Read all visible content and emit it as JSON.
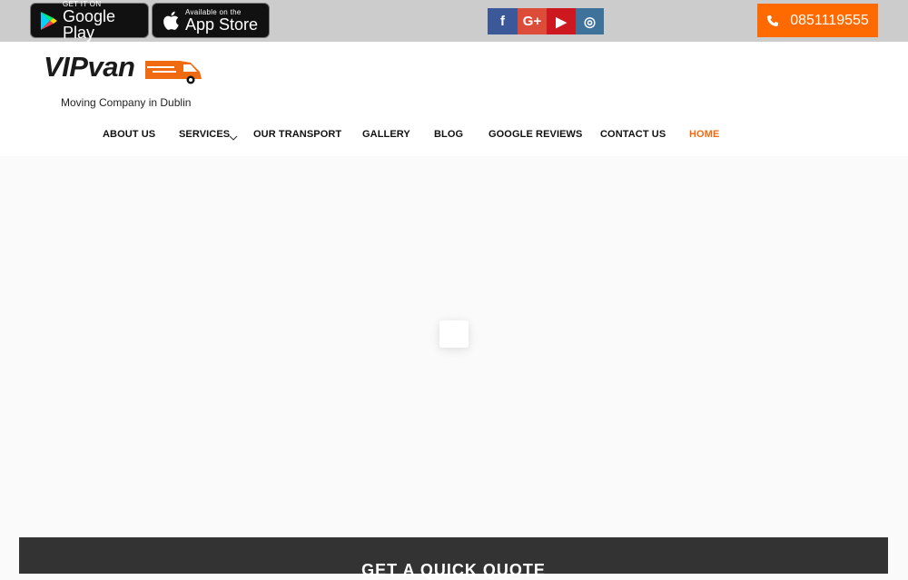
{
  "topbar": {
    "google_play": {
      "small": "GET IT ON",
      "big": "Google Play"
    },
    "app_store": {
      "small": "Available on the",
      "big": "App Store"
    },
    "social": [
      "f",
      "G+",
      "▶",
      "◎"
    ],
    "phone": "0851119555"
  },
  "brand": {
    "wordmark": "VIPvan",
    "tagline": "Moving Company in Dublin"
  },
  "nav": {
    "about": "ABOUT US",
    "services": "SERVICES",
    "transport": "OUR TRANSPORT",
    "gallery": "GALLERY",
    "blog": "BLOG",
    "reviews": "GOOGLE REVIEWS",
    "contact": "CONTACT US",
    "home": "HOME"
  },
  "quote": {
    "title": "GET A QUICK QUOTE"
  },
  "colors": {
    "accent": "#ff6a00",
    "topbar": "#cccccc",
    "quote_bg": "#333333"
  }
}
